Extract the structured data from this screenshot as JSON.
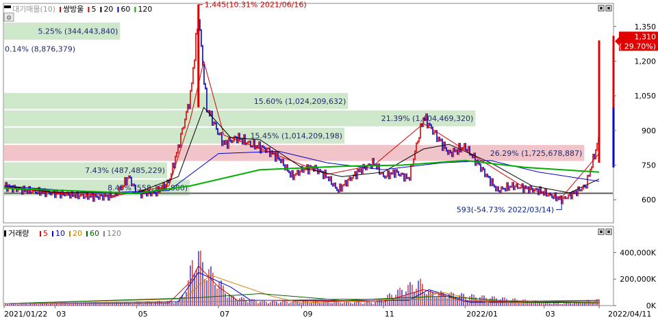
{
  "top_legend": {
    "prefix": "■",
    "label": "대기매물(10)",
    "sep": "마",
    "items": [
      {
        "label": "쌍방울",
        "color": "#d50000"
      },
      {
        "label": "5",
        "color": "#d50000"
      },
      {
        "label": "20",
        "color": "#000000"
      },
      {
        "label": "60",
        "color": "#0000cc"
      },
      {
        "label": "120",
        "color": "#00b000"
      }
    ]
  },
  "bottom_legend": {
    "label": "거래량",
    "items": [
      {
        "label": "5",
        "color": "#d50000"
      },
      {
        "label": "10",
        "color": "#0000cc"
      },
      {
        "label": "20",
        "color": "#d08000"
      },
      {
        "label": "60",
        "color": "#006000"
      },
      {
        "label": "120",
        "color": "#808080"
      }
    ]
  },
  "colors": {
    "up": "#e00000",
    "down": "#0000cc",
    "profile_green": "#cfe8cc",
    "profile_red": "#f0c4c8",
    "current_price_bg": "#e00000"
  },
  "chart_data": [
    {
      "type": "candlestick",
      "name": "price",
      "ylim": [
        500,
        1450
      ],
      "yticks": [
        {
          "value": 1350,
          "label": "1,350"
        },
        {
          "value": 1200,
          "label": "1,200"
        },
        {
          "value": 1050,
          "label": "1,050"
        },
        {
          "value": 900,
          "label": "900"
        },
        {
          "value": 750,
          "label": "750"
        },
        {
          "value": 600,
          "label": "600"
        }
      ],
      "x_start": "2021/01/22",
      "x_end": "2022/04/11",
      "high_marker": {
        "value": 1445,
        "date": "2021-06-16",
        "text": "1,445(10.31% 2021/06/16)"
      },
      "low_marker": {
        "value": 593,
        "date": "2022-03-14",
        "text": "593(-54.73% 2022/03/14)"
      },
      "current_price": {
        "value": 1310,
        "label": "1,310",
        "change": "( 29.70%)"
      },
      "horizontal_line": 628,
      "volume_profile": [
        {
          "price_lo": 1290,
          "price_hi": 1370,
          "pct_text": "5.25% (344,443,840)",
          "kind": "green",
          "width_frac": 0.195
        },
        {
          "price_lo": 1215,
          "price_hi": 1290,
          "pct_text": "0.14% (8,876,379)",
          "kind": "none",
          "width_frac": 0.005
        },
        {
          "price_lo": 990,
          "price_hi": 1065,
          "pct_text": "15.60% (1,024,209,632)",
          "kind": "green",
          "width_frac": 0.578
        },
        {
          "price_lo": 915,
          "price_hi": 990,
          "pct_text": "21.39% (1,404,469,320)",
          "kind": "green",
          "width_frac": 0.792
        },
        {
          "price_lo": 840,
          "price_hi": 915,
          "pct_text": "15.45% (1,014,209,198)",
          "kind": "green",
          "width_frac": 0.572
        },
        {
          "price_lo": 765,
          "price_hi": 840,
          "pct_text": "26.29% (1,725,678,887)",
          "kind": "red",
          "width_frac": 0.975
        },
        {
          "price_lo": 690,
          "price_hi": 765,
          "pct_text": "7.43% (487,485,229)",
          "kind": "green",
          "width_frac": 0.274
        },
        {
          "price_lo": 615,
          "price_hi": 690,
          "pct_text": "8.45% (558,134,880)",
          "kind": "green",
          "width_frac": 0.312
        }
      ],
      "price_series": [
        [
          "2021-01-22",
          660
        ],
        [
          "2021-02-01",
          645
        ],
        [
          "2021-02-15",
          635
        ],
        [
          "2021-03-01",
          628
        ],
        [
          "2021-03-15",
          620
        ],
        [
          "2021-04-01",
          612
        ],
        [
          "2021-04-15",
          618
        ],
        [
          "2021-04-25",
          700
        ],
        [
          "2021-05-01",
          628
        ],
        [
          "2021-05-15",
          630
        ],
        [
          "2021-05-25",
          680
        ],
        [
          "2021-06-01",
          830
        ],
        [
          "2021-06-10",
          1050
        ],
        [
          "2021-06-16",
          1400
        ],
        [
          "2021-06-22",
          1000
        ],
        [
          "2021-06-30",
          900
        ],
        [
          "2021-07-05",
          840
        ],
        [
          "2021-07-15",
          870
        ],
        [
          "2021-07-25",
          840
        ],
        [
          "2021-08-05",
          820
        ],
        [
          "2021-08-15",
          780
        ],
        [
          "2021-08-25",
          700
        ],
        [
          "2021-09-01",
          730
        ],
        [
          "2021-09-10",
          740
        ],
        [
          "2021-09-20",
          700
        ],
        [
          "2021-09-28",
          640
        ],
        [
          "2021-10-05",
          680
        ],
        [
          "2021-10-15",
          730
        ],
        [
          "2021-10-25",
          760
        ],
        [
          "2021-11-01",
          700
        ],
        [
          "2021-11-10",
          720
        ],
        [
          "2021-11-20",
          690
        ],
        [
          "2021-11-25",
          820
        ],
        [
          "2021-12-01",
          960
        ],
        [
          "2021-12-10",
          880
        ],
        [
          "2021-12-20",
          800
        ],
        [
          "2022-01-01",
          830
        ],
        [
          "2022-01-05",
          800
        ],
        [
          "2022-01-15",
          720
        ],
        [
          "2022-01-25",
          640
        ],
        [
          "2022-02-05",
          660
        ],
        [
          "2022-02-15",
          650
        ],
        [
          "2022-02-25",
          640
        ],
        [
          "2022-03-05",
          620
        ],
        [
          "2022-03-14",
          600
        ],
        [
          "2022-03-25",
          635
        ],
        [
          "2022-04-01",
          660
        ],
        [
          "2022-04-11",
          870
        ]
      ],
      "ma_series": [
        {
          "name": "5",
          "color": "#d50000",
          "values": [
            [
              "2021-01-22",
              655
            ],
            [
              "2021-03-01",
              630
            ],
            [
              "2021-04-15",
              618
            ],
            [
              "2021-05-25",
              660
            ],
            [
              "2021-06-10",
              950
            ],
            [
              "2021-06-20",
              1200
            ],
            [
              "2021-07-05",
              880
            ],
            [
              "2021-08-15",
              790
            ],
            [
              "2021-09-20",
              710
            ],
            [
              "2021-10-25",
              750
            ],
            [
              "2021-12-01",
              930
            ],
            [
              "2022-01-05",
              800
            ],
            [
              "2022-02-15",
              650
            ],
            [
              "2022-03-14",
              610
            ],
            [
              "2022-04-11",
              800
            ]
          ]
        },
        {
          "name": "20",
          "color": "#000000",
          "values": [
            [
              "2021-01-22",
              660
            ],
            [
              "2021-03-01",
              632
            ],
            [
              "2021-05-01",
              630
            ],
            [
              "2021-06-01",
              700
            ],
            [
              "2021-06-20",
              1000
            ],
            [
              "2021-07-10",
              870
            ],
            [
              "2021-08-01",
              860
            ],
            [
              "2021-09-01",
              740
            ],
            [
              "2021-10-01",
              700
            ],
            [
              "2021-11-01",
              720
            ],
            [
              "2021-12-01",
              820
            ],
            [
              "2021-12-20",
              840
            ],
            [
              "2022-01-20",
              760
            ],
            [
              "2022-02-20",
              660
            ],
            [
              "2022-03-20",
              630
            ],
            [
              "2022-04-11",
              690
            ]
          ]
        },
        {
          "name": "60",
          "color": "#0000cc",
          "values": [
            [
              "2021-01-22",
              660
            ],
            [
              "2021-04-01",
              630
            ],
            [
              "2021-05-25",
              640
            ],
            [
              "2021-07-01",
              800
            ],
            [
              "2021-08-15",
              810
            ],
            [
              "2021-09-20",
              760
            ],
            [
              "2021-11-01",
              730
            ],
            [
              "2021-12-15",
              760
            ],
            [
              "2022-01-20",
              770
            ],
            [
              "2022-02-25",
              720
            ],
            [
              "2022-04-11",
              680
            ]
          ]
        },
        {
          "name": "120",
          "color": "#00b000",
          "values": [
            [
              "2021-01-22",
              650
            ],
            [
              "2021-05-01",
              628
            ],
            [
              "2021-06-10",
              660
            ],
            [
              "2021-08-01",
              730
            ],
            [
              "2021-10-01",
              745
            ],
            [
              "2021-11-15",
              750
            ],
            [
              "2022-01-01",
              770
            ],
            [
              "2022-02-15",
              740
            ],
            [
              "2022-04-11",
              720
            ]
          ]
        }
      ]
    },
    {
      "type": "bar",
      "name": "volume",
      "ylim": [
        0,
        500
      ],
      "yticks": [
        {
          "value": 400,
          "label": "400,000K"
        },
        {
          "value": 200,
          "label": "200,000K"
        },
        {
          "value": 0,
          "label": "0K"
        }
      ],
      "volume_peaks": [
        [
          "2021-01-22",
          20
        ],
        [
          "2021-04-25",
          30
        ],
        [
          "2021-06-01",
          40
        ],
        [
          "2021-06-08",
          180
        ],
        [
          "2021-06-12",
          430
        ],
        [
          "2021-06-16",
          460
        ],
        [
          "2021-06-20",
          350
        ],
        [
          "2021-06-25",
          300
        ],
        [
          "2021-07-01",
          220
        ],
        [
          "2021-07-10",
          80
        ],
        [
          "2021-08-01",
          40
        ],
        [
          "2021-10-25",
          30
        ],
        [
          "2021-11-25",
          200
        ],
        [
          "2021-11-28",
          210
        ],
        [
          "2021-12-01",
          180
        ],
        [
          "2021-12-05",
          120
        ],
        [
          "2022-03-14",
          20
        ],
        [
          "2022-04-08",
          50
        ]
      ],
      "ma_series": [
        {
          "name": "5",
          "color": "#d50000",
          "values": [
            [
              "2021-01-22",
              15
            ],
            [
              "2021-05-25",
              20
            ],
            [
              "2021-06-10",
              180
            ],
            [
              "2021-06-16",
              300
            ],
            [
              "2021-07-01",
              140
            ],
            [
              "2021-07-15",
              40
            ],
            [
              "2021-11-01",
              30
            ],
            [
              "2021-12-01",
              120
            ],
            [
              "2022-01-01",
              30
            ],
            [
              "2022-04-11",
              40
            ]
          ]
        },
        {
          "name": "10",
          "color": "#0000cc",
          "values": [
            [
              "2021-01-22",
              15
            ],
            [
              "2021-06-01",
              30
            ],
            [
              "2021-06-16",
              250
            ],
            [
              "2021-07-10",
              140
            ],
            [
              "2021-07-25",
              40
            ],
            [
              "2021-11-20",
              40
            ],
            [
              "2021-12-05",
              120
            ],
            [
              "2022-01-05",
              25
            ],
            [
              "2022-04-11",
              30
            ]
          ]
        },
        {
          "name": "20",
          "color": "#d08000",
          "values": [
            [
              "2021-01-22",
              15
            ],
            [
              "2021-06-05",
              50
            ],
            [
              "2021-06-25",
              230
            ],
            [
              "2021-08-10",
              70
            ],
            [
              "2021-09-01",
              20
            ],
            [
              "2021-11-25",
              50
            ],
            [
              "2021-12-15",
              100
            ],
            [
              "2022-01-20",
              20
            ],
            [
              "2022-04-11",
              25
            ]
          ]
        },
        {
          "name": "60",
          "color": "#006000",
          "values": [
            [
              "2021-01-22",
              15
            ],
            [
              "2021-06-16",
              60
            ],
            [
              "2021-08-01",
              90
            ],
            [
              "2021-10-01",
              40
            ],
            [
              "2021-12-15",
              70
            ],
            [
              "2022-02-15",
              25
            ],
            [
              "2022-04-11",
              20
            ]
          ]
        },
        {
          "name": "120",
          "color": "#808080",
          "values": [
            [
              "2021-01-22",
              15
            ],
            [
              "2021-06-25",
              30
            ],
            [
              "2021-10-01",
              50
            ],
            [
              "2022-01-01",
              40
            ],
            [
              "2022-04-11",
              30
            ]
          ]
        }
      ]
    }
  ],
  "x_labels": [
    {
      "text": "2021/01/22",
      "date": "2021-01-22"
    },
    {
      "text": "03",
      "date": "2021-03-01"
    },
    {
      "text": "05",
      "date": "2021-05-01"
    },
    {
      "text": "07",
      "date": "2021-07-01"
    },
    {
      "text": "09",
      "date": "2021-09-01"
    },
    {
      "text": "11",
      "date": "2021-11-01"
    },
    {
      "text": "2022/01",
      "date": "2022-01-01"
    },
    {
      "text": "03",
      "date": "2022-03-01"
    },
    {
      "text": "2022/04/11",
      "date": "2022-04-11"
    }
  ]
}
